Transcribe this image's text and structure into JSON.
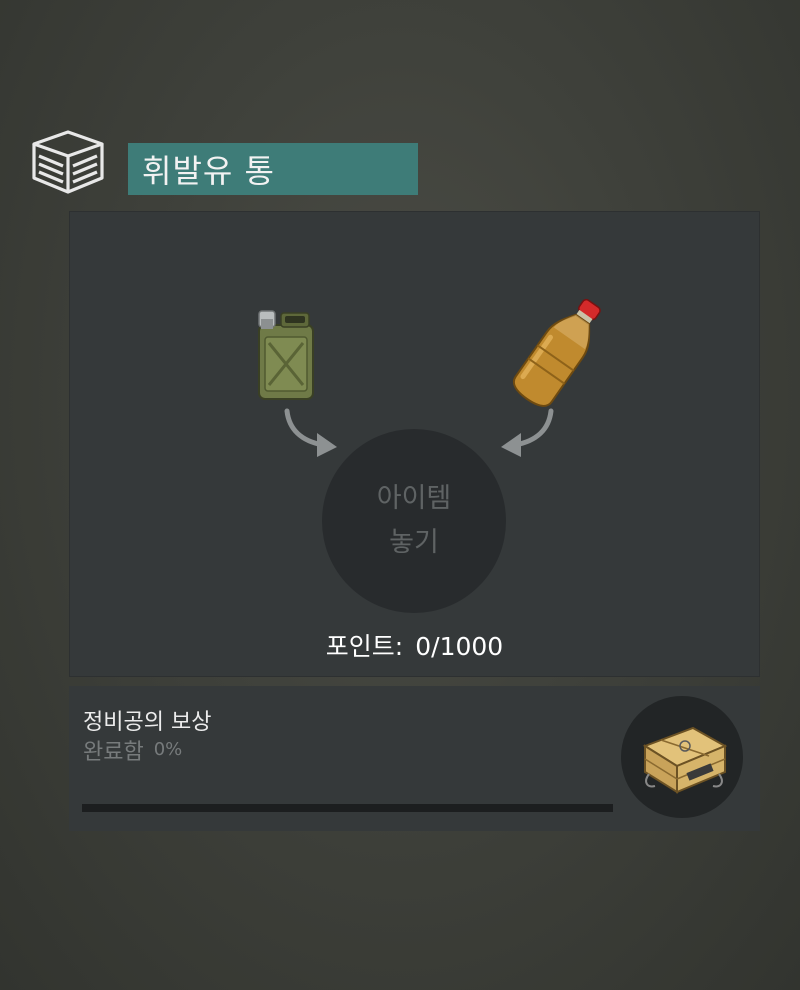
{
  "header": {
    "icon": "storage-box-icon",
    "title": "휘발유 통"
  },
  "crafting": {
    "ingredients": [
      {
        "icon": "jerrycan-icon"
      },
      {
        "icon": "plastic-bottle-icon"
      }
    ],
    "drop_zone": {
      "line1": "아이템",
      "line2": "놓기"
    },
    "points_label": "포인트:",
    "points_value": "0/1000"
  },
  "reward": {
    "title": "정비공의 보상",
    "status_label": "완료함",
    "status_percent": "0%",
    "progress": 0,
    "icon": "weapon-crate-icon"
  },
  "colors": {
    "title_bar": "#3e7c78",
    "panel": "#35393a",
    "drop_circle": "#282b2d"
  }
}
